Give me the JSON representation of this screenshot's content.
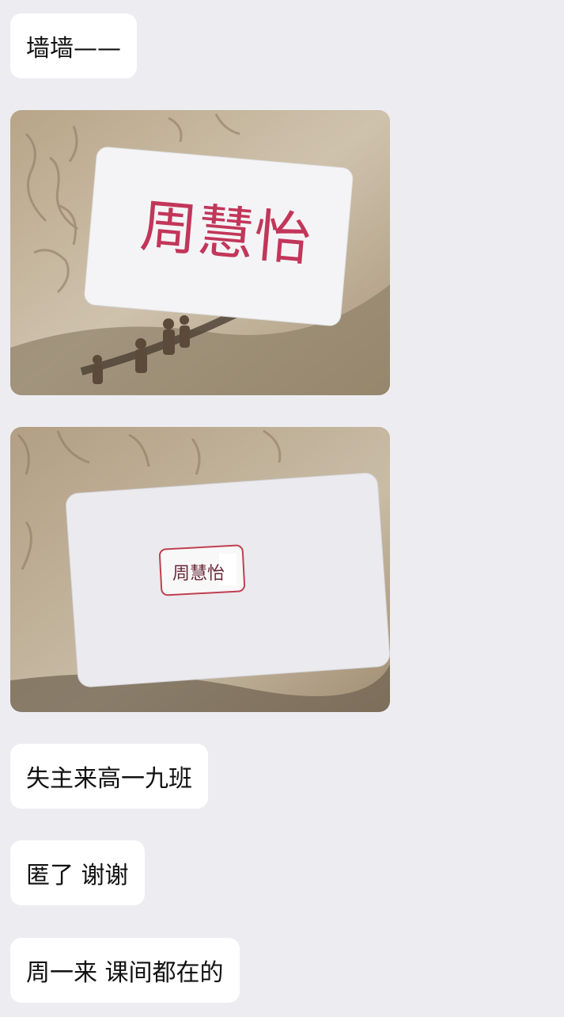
{
  "messages": [
    {
      "type": "text",
      "text": "墙墙——"
    },
    {
      "type": "image",
      "handwriting": "周慧怡"
    },
    {
      "type": "image",
      "handwriting": "周慧怡"
    },
    {
      "type": "text",
      "text": "失主来高一九班"
    },
    {
      "type": "text",
      "text": "匿了 谢谢"
    },
    {
      "type": "text",
      "text": "周一来 课间都在的"
    }
  ],
  "colors": {
    "background": "#ededf1",
    "bubble": "#ffffff",
    "ink_red": "#c2365a"
  }
}
